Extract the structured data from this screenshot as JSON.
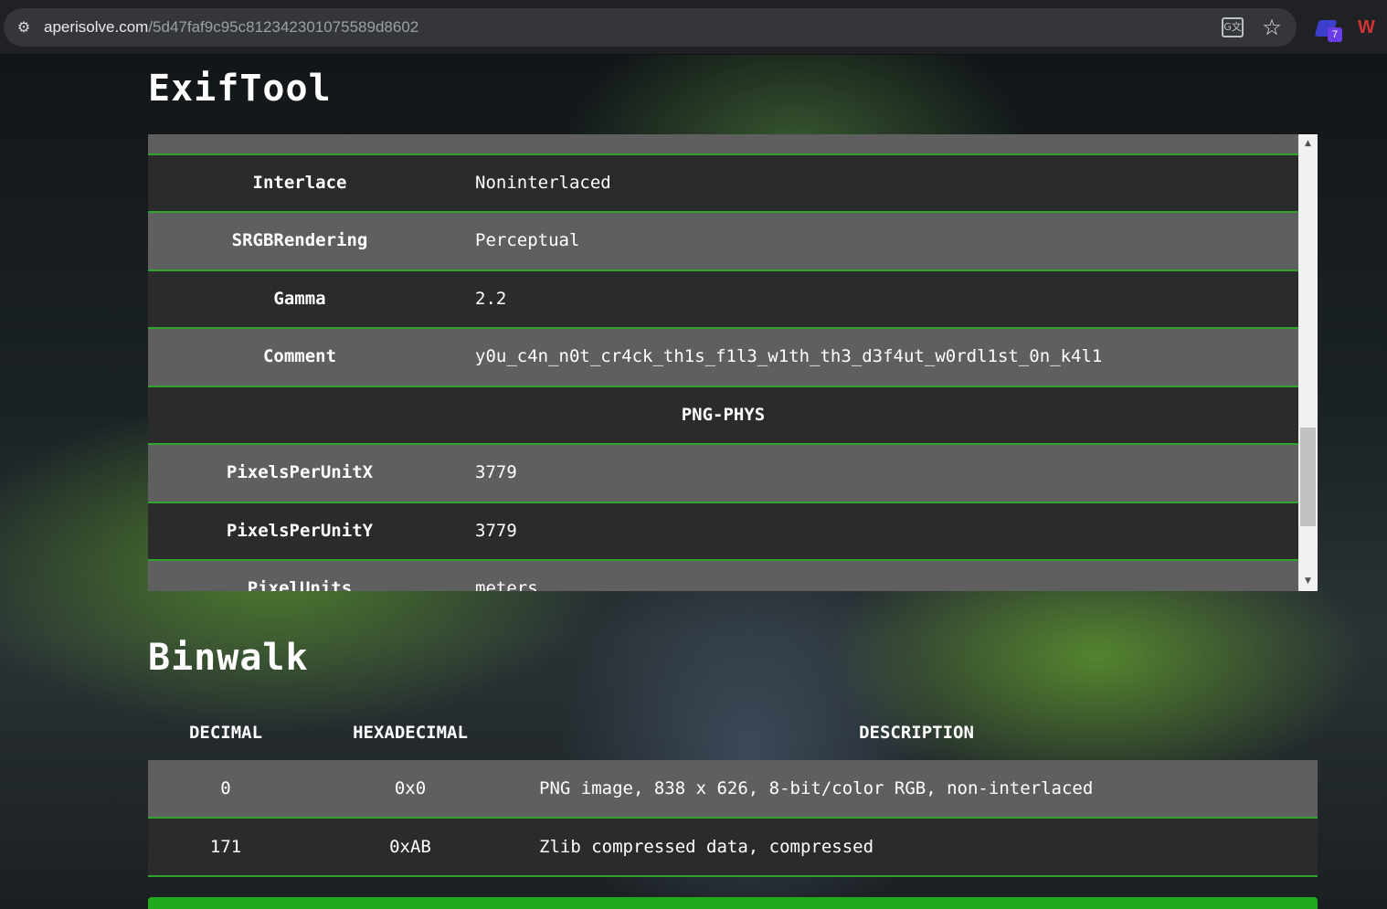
{
  "browser": {
    "url_domain": "aperisolve.com",
    "url_path": "/5d47faf9c95c812342301075589d8602",
    "extension_badge": "7",
    "extension_logo": "W"
  },
  "icons": {
    "site_info": "tune-icon",
    "translate": "translate-icon",
    "bookmark": "star-icon"
  },
  "exiftool": {
    "title": "ExifTool",
    "rows": [
      {
        "key": "",
        "value": "",
        "partial": true
      },
      {
        "key": "Interlace",
        "value": "Noninterlaced"
      },
      {
        "key": "SRGBRendering",
        "value": "Perceptual"
      },
      {
        "key": "Gamma",
        "value": "2.2"
      },
      {
        "key": "Comment",
        "value": "y0u_c4n_n0t_cr4ck_th1s_f1l3_w1th_th3_d3f4ut_w0rdl1st_0n_k4l1"
      },
      {
        "group": "PNG-PHYS"
      },
      {
        "key": "PixelsPerUnitX",
        "value": "3779"
      },
      {
        "key": "PixelsPerUnitY",
        "value": "3779"
      },
      {
        "key": "PixelUnits",
        "value": "meters"
      }
    ]
  },
  "binwalk": {
    "title": "Binwalk",
    "headers": {
      "decimal": "DECIMAL",
      "hexadecimal": "HEXADECIMAL",
      "description": "DESCRIPTION"
    },
    "rows": [
      {
        "decimal": "0",
        "hexadecimal": "0x0",
        "description": "PNG image, 838 x 626, 8-bit/color RGB, non-interlaced"
      },
      {
        "decimal": "171",
        "hexadecimal": "0xAB",
        "description": "Zlib compressed data, compressed"
      }
    ]
  },
  "colors": {
    "accent_green": "#21a81d",
    "row_alt": "#5f5f5f",
    "row_dark": "#2b2b2b"
  }
}
